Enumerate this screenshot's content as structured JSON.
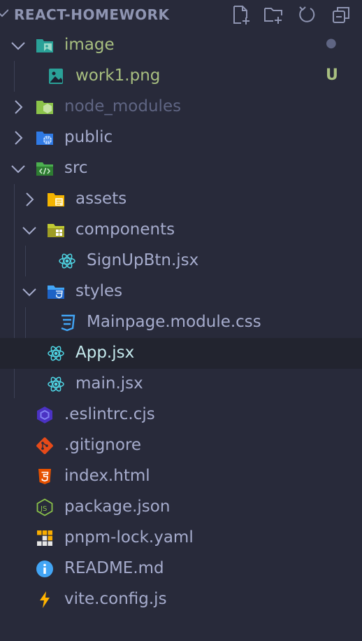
{
  "explorer": {
    "title": "REACT-HOMEWORK",
    "actions": [
      "new-file-icon",
      "new-folder-icon",
      "refresh-icon",
      "collapse-all-icon"
    ]
  },
  "tree": {
    "image": {
      "label": "image",
      "badge": "●"
    },
    "work1": {
      "label": "work1.png",
      "badge": "U"
    },
    "node_modules": {
      "label": "node_modules"
    },
    "public": {
      "label": "public"
    },
    "src": {
      "label": "src"
    },
    "assets": {
      "label": "assets"
    },
    "components": {
      "label": "components"
    },
    "signup": {
      "label": "SignUpBtn.jsx"
    },
    "styles": {
      "label": "styles"
    },
    "mainpage_css": {
      "label": "Mainpage.module.css"
    },
    "app": {
      "label": "App.jsx"
    },
    "main": {
      "label": "main.jsx"
    },
    "eslintrc": {
      "label": ".eslintrc.cjs"
    },
    "gitignore": {
      "label": ".gitignore"
    },
    "index_html": {
      "label": "index.html"
    },
    "package_json": {
      "label": "package.json"
    },
    "pnpm_lock": {
      "label": "pnpm-lock.yaml"
    },
    "readme": {
      "label": "README.md"
    },
    "vite_config": {
      "label": "vite.config.js"
    }
  },
  "colors": {
    "background": "#282a3a",
    "active_row": "#22242f",
    "modified_text": "#a8bf80",
    "untracked_badge": "#a8bf80",
    "dimmed_text": "#5f6583"
  }
}
